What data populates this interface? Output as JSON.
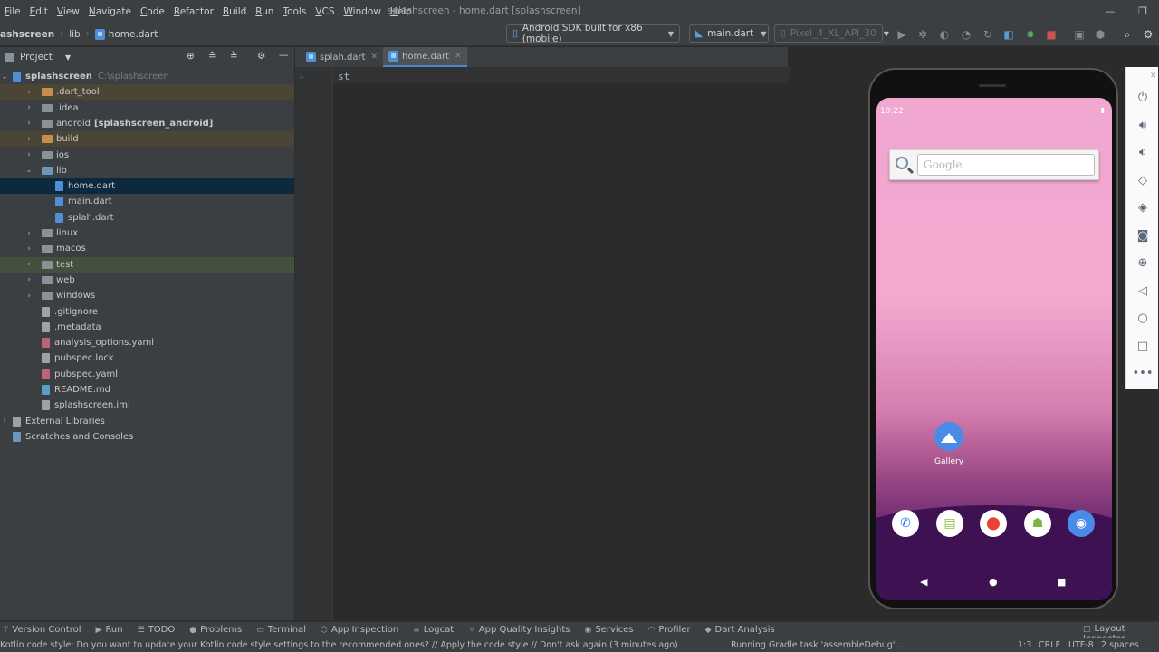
{
  "window": {
    "title": "splashscreen - home.dart [splashscreen]",
    "controls": [
      "—",
      "❐"
    ]
  },
  "menu": [
    "File",
    "Edit",
    "View",
    "Navigate",
    "Code",
    "Refactor",
    "Build",
    "Run",
    "Tools",
    "VCS",
    "Window",
    "Help"
  ],
  "breadcrumb": {
    "project": "ashscreen",
    "folder": "lib",
    "file": "home.dart"
  },
  "toolbar": {
    "device": "Android SDK built for x86 (mobile)",
    "run_config": "main.dart",
    "avd": "Pixel_4_XL_API_30"
  },
  "project_panel": {
    "title": "Project",
    "tree": [
      {
        "label": "splashscreen",
        "path": "C:\\splashscreen",
        "depth": 0,
        "kind": "root",
        "open": true
      },
      {
        "label": ".dart_tool",
        "depth": 1,
        "kind": "folder-orange",
        "hl": "orange"
      },
      {
        "label": ".idea",
        "depth": 1,
        "kind": "folder"
      },
      {
        "label": "android",
        "suffix": "[splashscreen_android]",
        "depth": 1,
        "kind": "folder"
      },
      {
        "label": "build",
        "depth": 1,
        "kind": "folder-orange",
        "hl": "orange"
      },
      {
        "label": "ios",
        "depth": 1,
        "kind": "folder"
      },
      {
        "label": "lib",
        "depth": 1,
        "kind": "folder-blue",
        "open": true
      },
      {
        "label": "home.dart",
        "depth": 2,
        "kind": "dart",
        "selected": true
      },
      {
        "label": "main.dart",
        "depth": 2,
        "kind": "dart"
      },
      {
        "label": "splah.dart",
        "depth": 2,
        "kind": "dart"
      },
      {
        "label": "linux",
        "depth": 1,
        "kind": "folder"
      },
      {
        "label": "macos",
        "depth": 1,
        "kind": "folder"
      },
      {
        "label": "test",
        "depth": 1,
        "kind": "folder",
        "hl": "green"
      },
      {
        "label": "web",
        "depth": 1,
        "kind": "folder"
      },
      {
        "label": "windows",
        "depth": 1,
        "kind": "folder"
      },
      {
        "label": ".gitignore",
        "depth": 1,
        "kind": "file"
      },
      {
        "label": ".metadata",
        "depth": 1,
        "kind": "file"
      },
      {
        "label": "analysis_options.yaml",
        "depth": 1,
        "kind": "yaml"
      },
      {
        "label": "pubspec.lock",
        "depth": 1,
        "kind": "file"
      },
      {
        "label": "pubspec.yaml",
        "depth": 1,
        "kind": "yaml"
      },
      {
        "label": "README.md",
        "depth": 1,
        "kind": "md"
      },
      {
        "label": "splashscreen.iml",
        "depth": 1,
        "kind": "file"
      },
      {
        "label": "External Libraries",
        "depth": 0,
        "kind": "lib"
      },
      {
        "label": "Scratches and Consoles",
        "depth": 0,
        "kind": "scratch"
      }
    ]
  },
  "editor": {
    "tabs": [
      {
        "label": "splah.dart",
        "active": false
      },
      {
        "label": "home.dart",
        "active": true
      }
    ],
    "line_number": "1",
    "code": "st"
  },
  "emulator": {
    "time": "10:22",
    "search_placeholder": "Google",
    "gallery_label": "Gallery",
    "dock": [
      "phone-icon",
      "store-icon",
      "maps-icon",
      "android-icon",
      "camera-icon"
    ]
  },
  "bottom_tools": [
    {
      "label": "Version Control",
      "icon": "vcs-icon"
    },
    {
      "label": "Run",
      "icon": "run-icon"
    },
    {
      "label": "TODO",
      "icon": "todo-icon"
    },
    {
      "label": "Problems",
      "icon": "problems-icon"
    },
    {
      "label": "Terminal",
      "icon": "terminal-icon"
    },
    {
      "label": "App Inspection",
      "icon": "inspection-icon"
    },
    {
      "label": "Logcat",
      "icon": "logcat-icon"
    },
    {
      "label": "App Quality Insights",
      "icon": "quality-icon"
    },
    {
      "label": "Services",
      "icon": "services-icon"
    },
    {
      "label": "Profiler",
      "icon": "profiler-icon"
    },
    {
      "label": "Dart Analysis",
      "icon": "dart-analysis-icon"
    }
  ],
  "layout_inspector": "Layout Inspector",
  "status": {
    "message": "Kotlin code style: Do you want to update your Kotlin code style settings to the recommended ones? // Apply the code style // Don't ask again (3 minutes ago)",
    "task": "Running Gradle task 'assembleDebug'...",
    "position": "1:3",
    "line_sep": "CRLF",
    "encoding": "UTF-8",
    "indent": "2 spaces"
  }
}
